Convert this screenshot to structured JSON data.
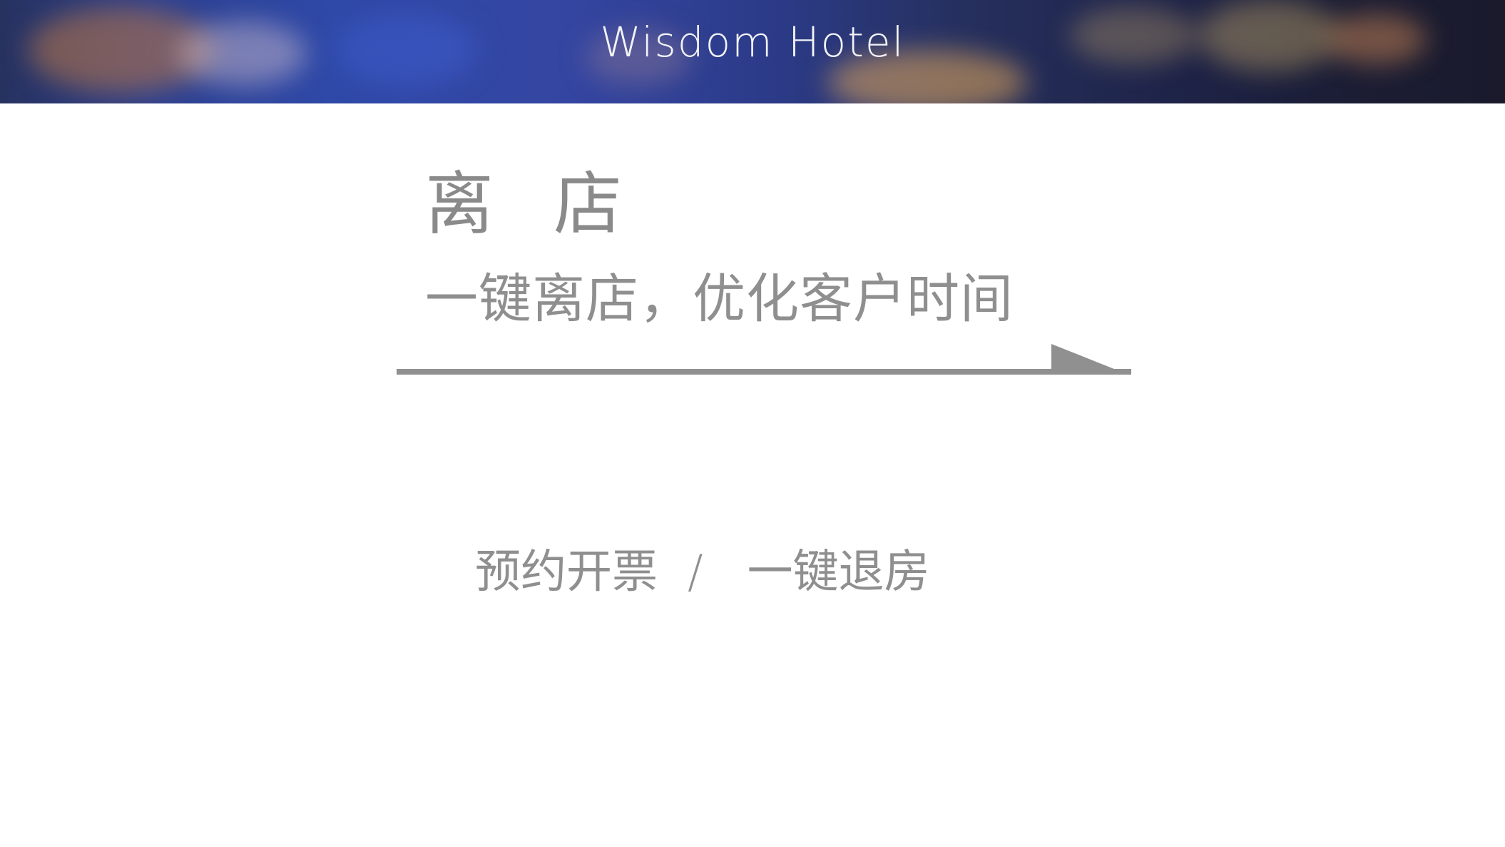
{
  "banner": {
    "title": "Wisdom Hotel"
  },
  "heading": {
    "part1": "离",
    "part2": "店"
  },
  "subheading": "一键离店，优化客户时间",
  "actions": {
    "left": "预约开票",
    "separator": "/",
    "right": "一键退房"
  },
  "colors": {
    "text_gray": "#8f8f8f",
    "arrow_gray": "#909090",
    "banner_blue": "#2f49a8",
    "banner_dark": "#1a1a2c"
  },
  "icons": {
    "arrow": "right-arrow-icon"
  }
}
